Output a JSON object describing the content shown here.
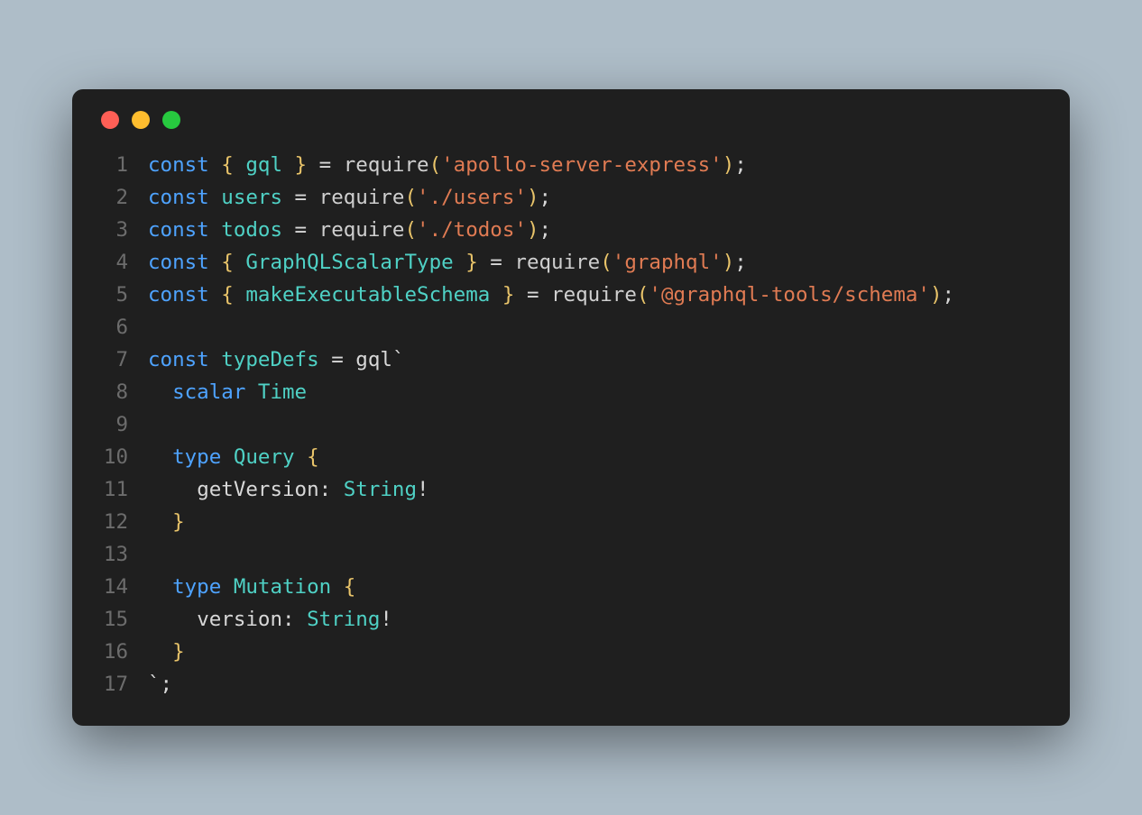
{
  "traffic_lights": [
    "red",
    "yellow",
    "green"
  ],
  "colors": {
    "red": "#ff5f56",
    "yellow": "#ffbd2e",
    "green": "#27c93f",
    "bg": "#1f1f1f",
    "page_bg": "#aebdc8"
  },
  "code": {
    "lines": [
      {
        "num": "1",
        "tokens": [
          {
            "t": "const ",
            "c": "kw"
          },
          {
            "t": "{ ",
            "c": "brace"
          },
          {
            "t": "gql",
            "c": "prop"
          },
          {
            "t": " }",
            "c": "brace"
          },
          {
            "t": " = ",
            "c": "punct"
          },
          {
            "t": "require",
            "c": "fn"
          },
          {
            "t": "(",
            "c": "brace"
          },
          {
            "t": "'apollo-server-express'",
            "c": "str"
          },
          {
            "t": ")",
            "c": "brace"
          },
          {
            "t": ";",
            "c": "punct"
          }
        ]
      },
      {
        "num": "2",
        "tokens": [
          {
            "t": "const ",
            "c": "kw"
          },
          {
            "t": "users",
            "c": "prop"
          },
          {
            "t": " = ",
            "c": "punct"
          },
          {
            "t": "require",
            "c": "fn"
          },
          {
            "t": "(",
            "c": "brace"
          },
          {
            "t": "'./users'",
            "c": "str"
          },
          {
            "t": ")",
            "c": "brace"
          },
          {
            "t": ";",
            "c": "punct"
          }
        ]
      },
      {
        "num": "3",
        "tokens": [
          {
            "t": "const ",
            "c": "kw"
          },
          {
            "t": "todos",
            "c": "prop"
          },
          {
            "t": " = ",
            "c": "punct"
          },
          {
            "t": "require",
            "c": "fn"
          },
          {
            "t": "(",
            "c": "brace"
          },
          {
            "t": "'./todos'",
            "c": "str"
          },
          {
            "t": ")",
            "c": "brace"
          },
          {
            "t": ";",
            "c": "punct"
          }
        ]
      },
      {
        "num": "4",
        "tokens": [
          {
            "t": "const ",
            "c": "kw"
          },
          {
            "t": "{ ",
            "c": "brace"
          },
          {
            "t": "GraphQLScalarType",
            "c": "prop"
          },
          {
            "t": " }",
            "c": "brace"
          },
          {
            "t": " = ",
            "c": "punct"
          },
          {
            "t": "require",
            "c": "fn"
          },
          {
            "t": "(",
            "c": "brace"
          },
          {
            "t": "'graphql'",
            "c": "str"
          },
          {
            "t": ")",
            "c": "brace"
          },
          {
            "t": ";",
            "c": "punct"
          }
        ]
      },
      {
        "num": "5",
        "tokens": [
          {
            "t": "const ",
            "c": "kw"
          },
          {
            "t": "{ ",
            "c": "brace"
          },
          {
            "t": "makeExecutableSchema",
            "c": "prop"
          },
          {
            "t": " }",
            "c": "brace"
          },
          {
            "t": " = ",
            "c": "punct"
          },
          {
            "t": "require",
            "c": "fn"
          },
          {
            "t": "(",
            "c": "brace"
          },
          {
            "t": "'@graphql-tools/schema'",
            "c": "str"
          },
          {
            "t": ")",
            "c": "brace"
          },
          {
            "t": ";",
            "c": "punct"
          }
        ]
      },
      {
        "num": "6",
        "tokens": [
          {
            "t": "",
            "c": "punct"
          }
        ]
      },
      {
        "num": "7",
        "tokens": [
          {
            "t": "const ",
            "c": "kw"
          },
          {
            "t": "typeDefs",
            "c": "prop"
          },
          {
            "t": " = ",
            "c": "punct"
          },
          {
            "t": "gql",
            "c": "ident"
          },
          {
            "t": "`",
            "c": "punct"
          }
        ]
      },
      {
        "num": "8",
        "tokens": [
          {
            "t": "  ",
            "c": "punct"
          },
          {
            "t": "scalar ",
            "c": "tl-kw"
          },
          {
            "t": "Time",
            "c": "type"
          }
        ]
      },
      {
        "num": "9",
        "tokens": [
          {
            "t": "",
            "c": "punct"
          }
        ]
      },
      {
        "num": "10",
        "tokens": [
          {
            "t": "  ",
            "c": "punct"
          },
          {
            "t": "type ",
            "c": "tl-kw"
          },
          {
            "t": "Query",
            "c": "type"
          },
          {
            "t": " {",
            "c": "brace"
          }
        ]
      },
      {
        "num": "11",
        "tokens": [
          {
            "t": "    ",
            "c": "punct"
          },
          {
            "t": "getVersion",
            "c": "ident"
          },
          {
            "t": ": ",
            "c": "punct"
          },
          {
            "t": "String",
            "c": "type"
          },
          {
            "t": "!",
            "c": "punct"
          }
        ]
      },
      {
        "num": "12",
        "tokens": [
          {
            "t": "  ",
            "c": "punct"
          },
          {
            "t": "}",
            "c": "brace"
          }
        ]
      },
      {
        "num": "13",
        "tokens": [
          {
            "t": "",
            "c": "punct"
          }
        ]
      },
      {
        "num": "14",
        "tokens": [
          {
            "t": "  ",
            "c": "punct"
          },
          {
            "t": "type ",
            "c": "tl-kw"
          },
          {
            "t": "Mutation",
            "c": "type"
          },
          {
            "t": " {",
            "c": "brace"
          }
        ]
      },
      {
        "num": "15",
        "tokens": [
          {
            "t": "    ",
            "c": "punct"
          },
          {
            "t": "version",
            "c": "ident"
          },
          {
            "t": ": ",
            "c": "punct"
          },
          {
            "t": "String",
            "c": "type"
          },
          {
            "t": "!",
            "c": "punct"
          }
        ]
      },
      {
        "num": "16",
        "tokens": [
          {
            "t": "  ",
            "c": "punct"
          },
          {
            "t": "}",
            "c": "brace"
          }
        ]
      },
      {
        "num": "17",
        "tokens": [
          {
            "t": "`",
            "c": "punct"
          },
          {
            "t": ";",
            "c": "punct"
          }
        ]
      }
    ]
  }
}
